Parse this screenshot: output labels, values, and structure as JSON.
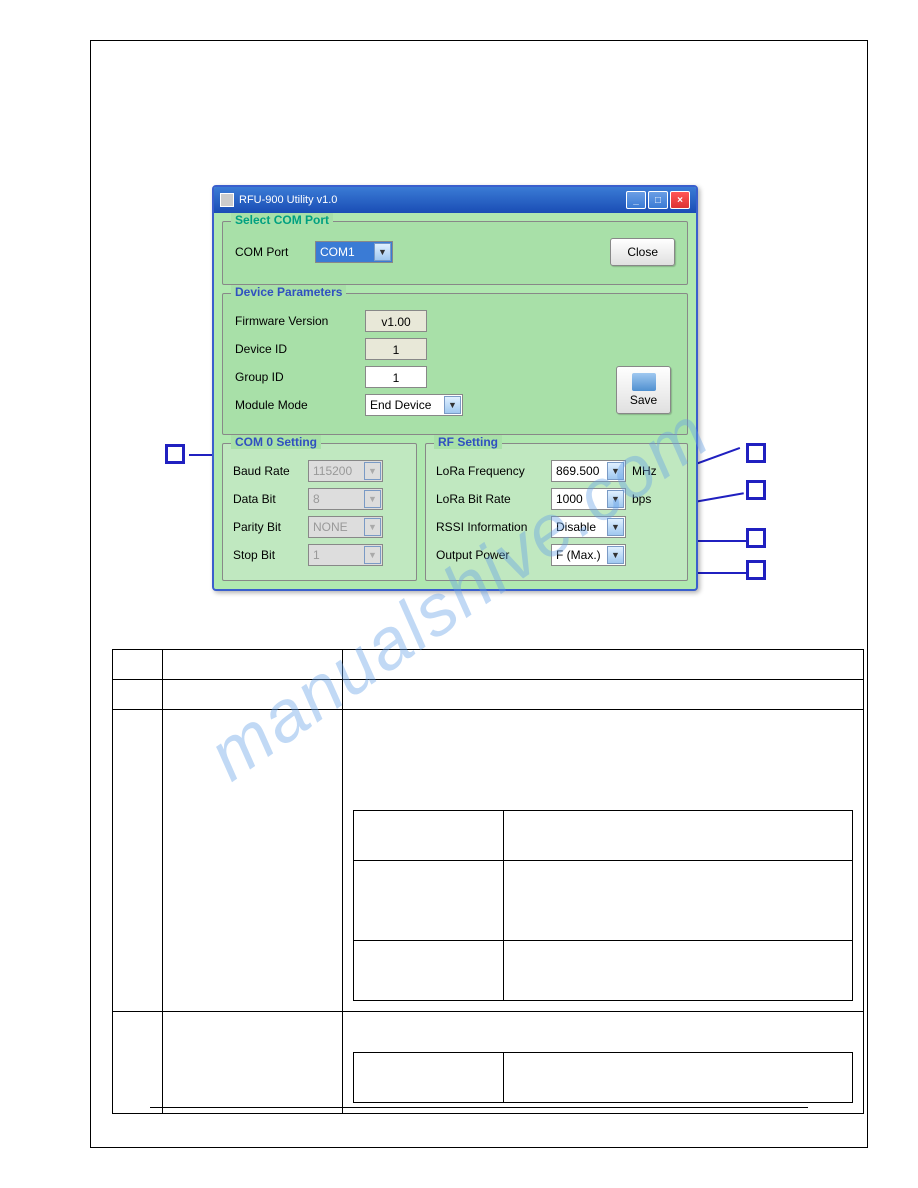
{
  "watermark": "manualshive.com",
  "window": {
    "title": "RFU-900 Utility v1.0"
  },
  "com_port": {
    "section_title": "Select COM Port",
    "label": "COM Port",
    "value": "COM1",
    "close_label": "Close"
  },
  "device_params": {
    "section_title": "Device Parameters",
    "firmware_label": "Firmware Version",
    "firmware_value": "v1.00",
    "device_id_label": "Device ID",
    "device_id_value": "1",
    "group_id_label": "Group ID",
    "group_id_value": "1",
    "module_mode_label": "Module Mode",
    "module_mode_value": "End Device",
    "save_label": "Save"
  },
  "com0": {
    "section_title": "COM 0 Setting",
    "baud_label": "Baud Rate",
    "baud_value": "115200",
    "data_bit_label": "Data Bit",
    "data_bit_value": "8",
    "parity_label": "Parity Bit",
    "parity_value": "NONE",
    "stop_bit_label": "Stop Bit",
    "stop_bit_value": "1"
  },
  "rf": {
    "section_title": "RF Setting",
    "freq_label": "LoRa Frequency",
    "freq_value": "869.500",
    "freq_unit": "MHz",
    "bitrate_label": "LoRa Bit Rate",
    "bitrate_value": "1000",
    "bitrate_unit": "bps",
    "rssi_label": "RSSI Information",
    "rssi_value": "Disable",
    "power_label": "Output Power",
    "power_value": "F (Max.)"
  }
}
